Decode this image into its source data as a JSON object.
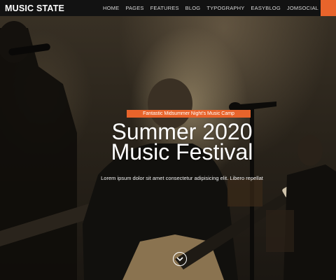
{
  "brand": {
    "logo": "MUSIC STATE"
  },
  "nav": {
    "items": [
      "HOME",
      "PAGES",
      "FEATURES",
      "BLOG",
      "TYPOGRAPHY",
      "EASYBLOG",
      "JOMSOCIAL"
    ],
    "menu_icon": "menu-icon"
  },
  "hero": {
    "badge": "Fantastic Midsummer Night's Music Camp",
    "title_line1": "Summer 2020",
    "title_line2": "Music Festival",
    "description": "Lorem ipsum dolor sit amet consectetur adipisicing elit. Libero repellat",
    "scroll_icon": "chevron-down-circle-icon"
  },
  "colors": {
    "accent": "#e8642b",
    "navbar": "#121212",
    "text": "#ffffff"
  }
}
